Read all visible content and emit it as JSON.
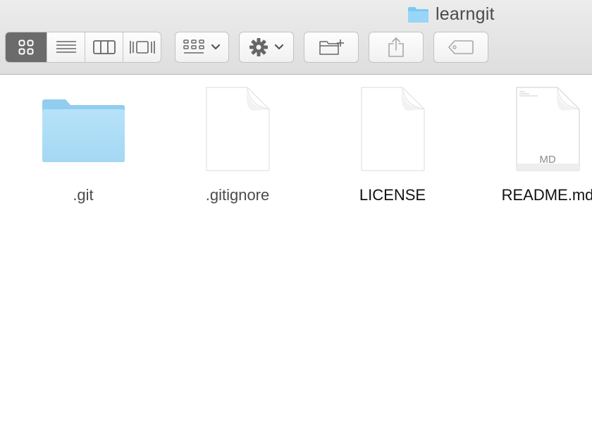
{
  "window": {
    "title": "learngit"
  },
  "toolbar": {
    "view_modes": [
      "icon-view",
      "list-view",
      "column-view",
      "cover-flow-view"
    ],
    "active_view": "icon-view",
    "arrange_icon": "group-arrange-icon",
    "action_icon": "gear-icon",
    "new_folder_icon": "new-folder-icon",
    "share_icon": "share-icon",
    "tags_icon": "tag-icon"
  },
  "files": [
    {
      "name": ".git",
      "kind": "folder"
    },
    {
      "name": ".gitignore",
      "kind": "document"
    },
    {
      "name": "LICENSE",
      "kind": "document"
    },
    {
      "name": "README.md",
      "kind": "markdown",
      "badge": "MD"
    }
  ],
  "colors": {
    "toolbar_bg": "#e5e5e5",
    "active_segment": "#6b6b6b",
    "folder_blue": "#a9dcf7"
  }
}
